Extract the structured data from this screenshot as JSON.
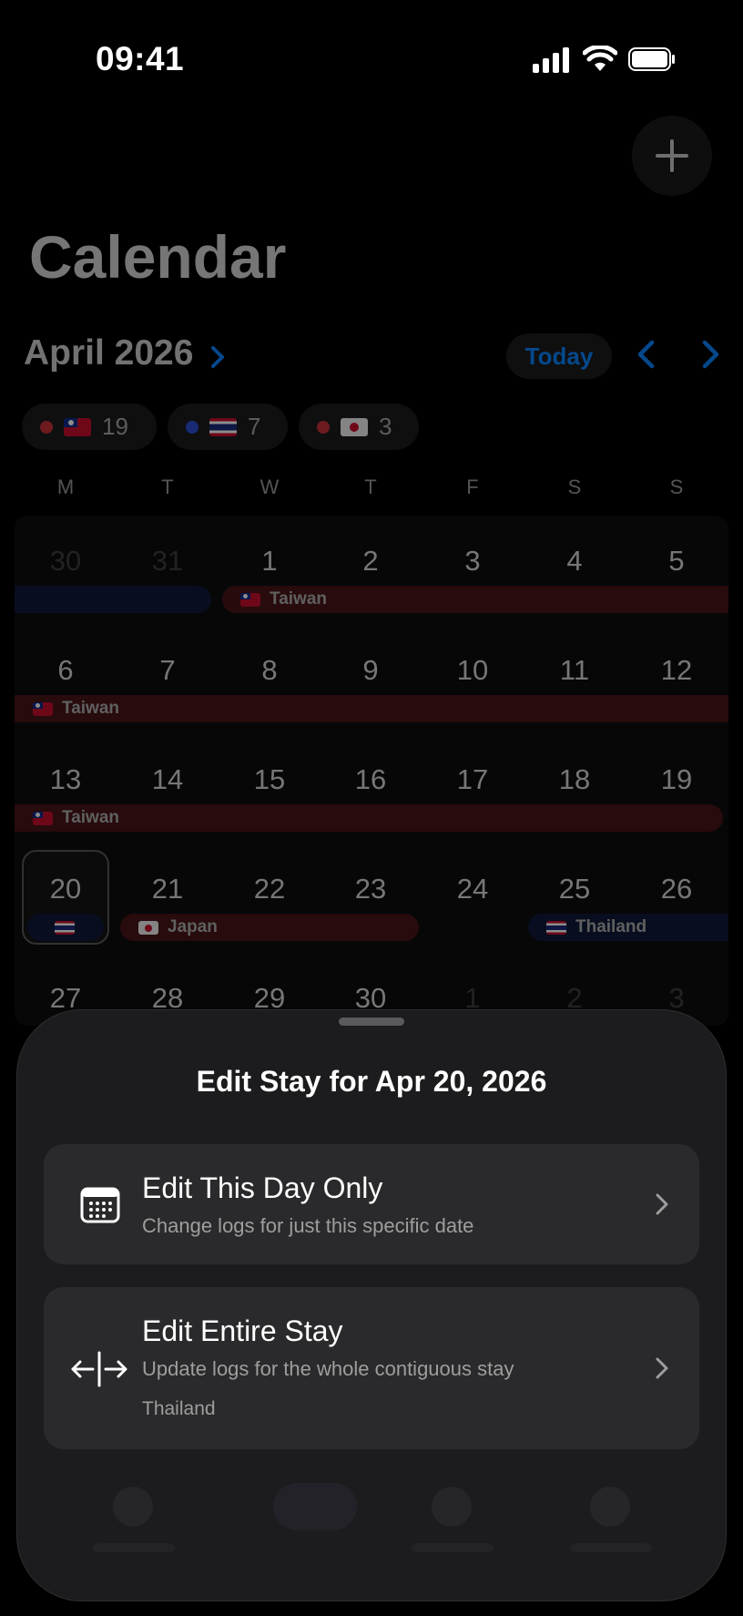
{
  "status_bar": {
    "time": "09:41"
  },
  "header": {
    "title": "Calendar",
    "month_label": "April 2026",
    "today_label": "Today"
  },
  "summary_chips": [
    {
      "country": "Taiwan",
      "count": "19",
      "dot_color": "#ff453a"
    },
    {
      "country": "Thailand",
      "count": "7",
      "dot_color": "#2f5bff"
    },
    {
      "country": "Japan",
      "count": "3",
      "dot_color": "#ff453a"
    }
  ],
  "weekdays": [
    "M",
    "T",
    "W",
    "T",
    "F",
    "S",
    "S"
  ],
  "weeks": [
    {
      "days": [
        "30",
        "31",
        "1",
        "2",
        "3",
        "4",
        "5"
      ]
    },
    {
      "days": [
        "6",
        "7",
        "8",
        "9",
        "10",
        "11",
        "12"
      ]
    },
    {
      "days": [
        "13",
        "14",
        "15",
        "16",
        "17",
        "18",
        "19"
      ]
    },
    {
      "days": [
        "20",
        "21",
        "22",
        "23",
        "24",
        "25",
        "26"
      ]
    },
    {
      "days": [
        "27",
        "28",
        "29",
        "30",
        "1",
        "2",
        "3"
      ]
    }
  ],
  "stays": {
    "week1_taiwan": "Taiwan",
    "week2_taiwan": "Taiwan",
    "week3_taiwan": "Taiwan",
    "week4_japan": "Japan",
    "week4_thailand": "Thailand"
  },
  "colors": {
    "accent": "#0a84ff",
    "stay_red": "#4a1518",
    "stay_blue": "#101a3a"
  },
  "sheet": {
    "title": "Edit Stay for Apr 20, 2026",
    "options": [
      {
        "icon": "calendar-icon",
        "title": "Edit This Day Only",
        "subtitle": "Change logs for just this specific date"
      },
      {
        "icon": "split-arrows-icon",
        "title": "Edit Entire Stay",
        "subtitle": "Update logs for the whole contiguous stay",
        "detail": "Thailand"
      }
    ]
  }
}
